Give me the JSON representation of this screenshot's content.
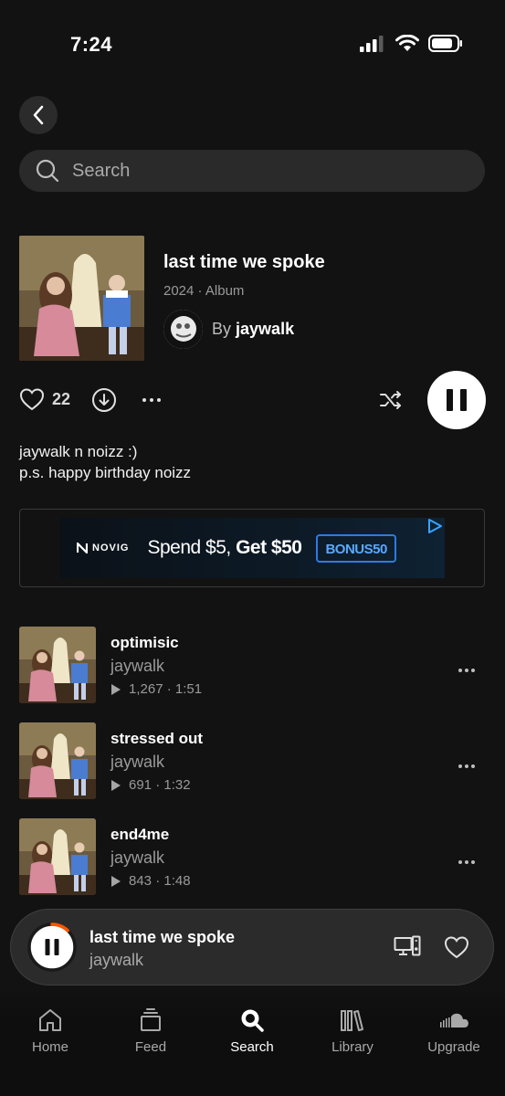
{
  "status": {
    "time": "7:24"
  },
  "search": {
    "placeholder": "Search"
  },
  "album": {
    "title": "last time we spoke",
    "year": "2024",
    "type": "Album",
    "by_prefix": "By",
    "artist": "jaywalk"
  },
  "actions": {
    "like_count": "22"
  },
  "description": {
    "line1": "jaywalk n noizz :)",
    "line2": "p.s. happy birthday noizz"
  },
  "ad": {
    "brand": "NOVIG",
    "headline_part1": "Spend $5,",
    "headline_part2": "Get $50",
    "code": "BONUS50"
  },
  "tracks": [
    {
      "title": "optimisic",
      "artist": "jaywalk",
      "plays": "1,267",
      "duration": "1:51"
    },
    {
      "title": "stressed out",
      "artist": "jaywalk",
      "plays": "691",
      "duration": "1:32"
    },
    {
      "title": "end4me",
      "artist": "jaywalk",
      "plays": "843",
      "duration": "1:48"
    }
  ],
  "now_playing": {
    "title": "last time we spoke",
    "artist": "jaywalk",
    "progress": 0.12,
    "accent": "#ff5500"
  },
  "nav": {
    "home": "Home",
    "feed": "Feed",
    "search": "Search",
    "library": "Library",
    "upgrade": "Upgrade"
  }
}
